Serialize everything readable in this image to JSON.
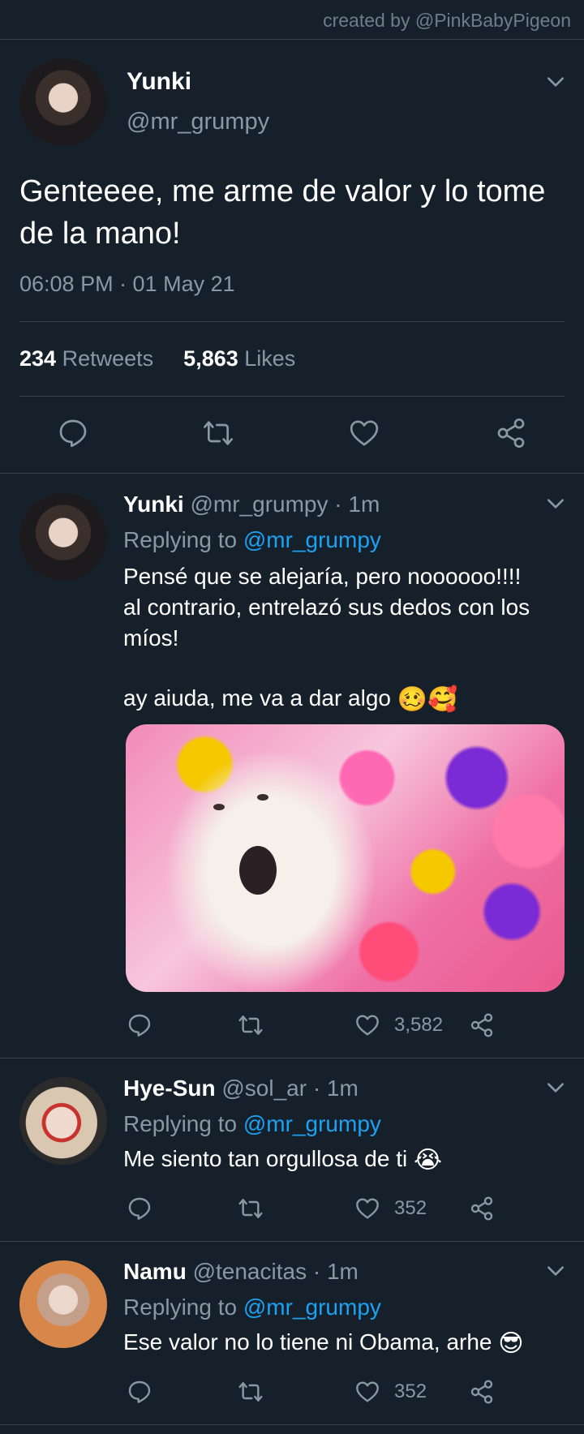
{
  "credit": "created by @PinkBabyPigeon",
  "main_tweet": {
    "name": "Yunki",
    "handle": "@mr_grumpy",
    "text": "Genteeee, me arme de valor y lo tome de la mano!",
    "time": "06:08 PM · 01 May 21",
    "retweets_count": "234",
    "retweets_label": "Retweets",
    "likes_count": "5,863",
    "likes_label": "Likes"
  },
  "replies": [
    {
      "name": "Yunki",
      "handle": "@mr_grumpy · 1m",
      "replying_label": "Replying to",
      "replying_to": "@mr_grumpy",
      "text_line1": "Pensé que se alejaría, pero noooooo!!!!",
      "text_line2": "al contrario, entrelazó sus dedos con los",
      "text_line3": "míos!",
      "text_line4": "ay aiuda, me va a dar algo",
      "emojis": "🥴🥰",
      "likes": "3,582",
      "has_media": true
    },
    {
      "name": "Hye-Sun",
      "handle": "@sol_ar · 1m",
      "replying_label": "Replying to",
      "replying_to": "@mr_grumpy",
      "text_line1": "Me siento tan orgullosa de ti",
      "emojis": "😭",
      "likes": "352"
    },
    {
      "name": "Namu",
      "handle": "@tenacitas · 1m",
      "replying_label": "Replying to",
      "replying_to": "@mr_grumpy",
      "text_line1": "Ese valor no lo tiene ni Obama, arhe",
      "emojis": "😎",
      "likes": "352"
    }
  ],
  "colors": {
    "background": "#15202b",
    "divider": "#38444d",
    "secondary_text": "#8899a6",
    "link": "#1da1f2"
  },
  "icons": [
    "chevron-down-icon",
    "reply-icon",
    "retweet-icon",
    "like-icon",
    "share-icon"
  ]
}
